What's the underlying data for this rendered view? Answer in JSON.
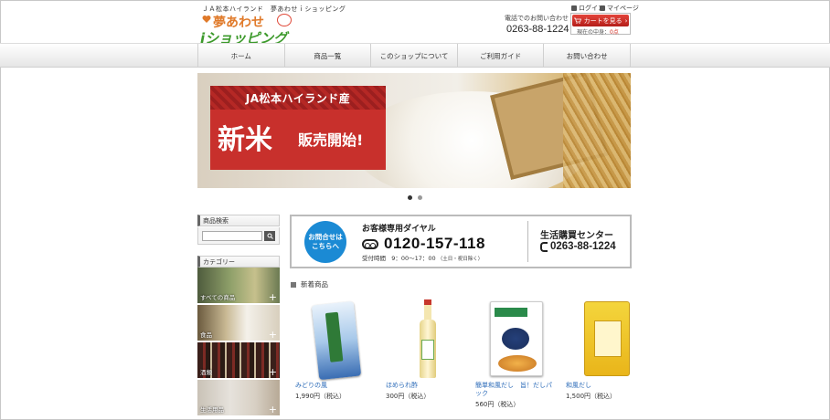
{
  "header": {
    "site_caption": "ＪＡ松本ハイランド　夢あわせｉショッピング",
    "logo_line1": "夢あわせ",
    "logo_line2": "iショッピング",
    "login": "ログイン",
    "mypage": "マイページ",
    "contact_label": "電話でのお問い合わせ",
    "contact_phone": "0263-88-1224",
    "cart_button": "カートを見る",
    "cart_status": "現在の中身",
    "cart_value": "0点"
  },
  "nav": [
    "ホーム",
    "商品一覧",
    "このショップについて",
    "ご利用ガイド",
    "お問い合わせ"
  ],
  "hero": {
    "line_top": "JA松本ハイランド産",
    "main": "新米",
    "sub": "販売開始!"
  },
  "sidebar": {
    "search_title": "商品検索",
    "search_placeholder": "",
    "category_title": "カテゴリー",
    "categories": [
      "すべての商品",
      "食品",
      "酒類",
      "生活用品"
    ]
  },
  "call_banner": {
    "circle_text": "お問合せは こちらへ",
    "label": "お客様専用ダイヤル",
    "free_number": "0120-157-118",
    "hours_label": "受付時間",
    "hours": "9：00～17：00",
    "hours_note": "（土日・祝日除く）",
    "center_name": "生活購買センター",
    "center_phone": "0263-88-1224"
  },
  "new_items": {
    "title": "新着商品",
    "products": [
      {
        "name": "みどりの風",
        "price": "1,990円（税込）"
      },
      {
        "name": "ほめられ酢",
        "price": "300円（税込）"
      },
      {
        "name": "簡単和風だし　旨！だしパック",
        "price": "560円（税込）"
      },
      {
        "name": "和風だし",
        "price": "1,500円（税込）"
      }
    ]
  },
  "colors": {
    "brand_green": "#3d9a2c",
    "brand_orange": "#e07a2a",
    "accent_red": "#c8302c",
    "call_blue": "#1b8ad4",
    "link_blue": "#2a6ab8"
  }
}
